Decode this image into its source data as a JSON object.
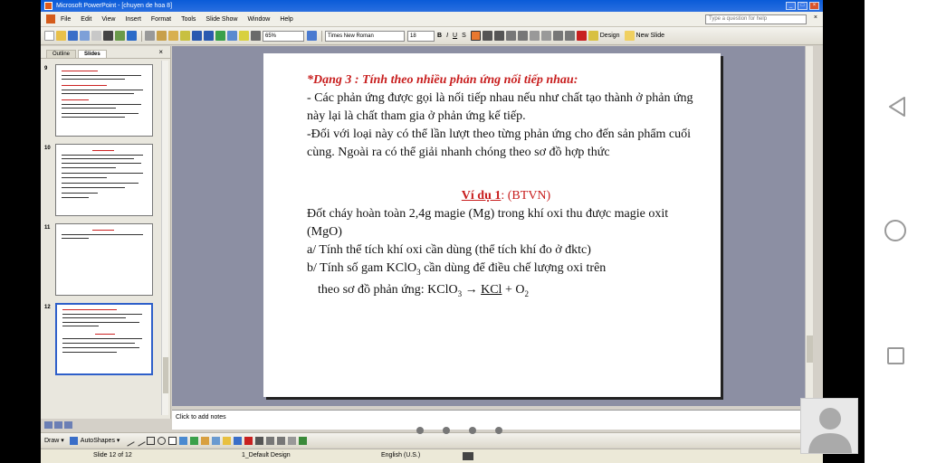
{
  "window": {
    "title": "Microsoft PowerPoint - [chuyen de hoa 8]",
    "help_placeholder": "Type a question for help"
  },
  "menu": [
    "File",
    "Edit",
    "View",
    "Insert",
    "Format",
    "Tools",
    "Slide Show",
    "Window",
    "Help"
  ],
  "toolbar": {
    "zoom": "65%",
    "font": "Times New Roman",
    "font_size": "18",
    "bold": "B",
    "italic": "I",
    "underline": "U",
    "shadow": "S",
    "design": "Design",
    "new_slide": "New Slide"
  },
  "panel": {
    "tabs": [
      "Outline",
      "Slides"
    ],
    "thumbnails": [
      {
        "num": "9"
      },
      {
        "num": "10"
      },
      {
        "num": "11"
      },
      {
        "num": "12"
      }
    ]
  },
  "slide": {
    "heading": "*Dạng  3 : Tính theo nhiều phản ứng nối tiếp nhau:",
    "para1": "- Các phản ứng được gọi là nối tiếp nhau nếu như chất tạo thành ở phản ứng này lại là chất tham gia ở phản ứng kế tiếp.",
    "para2": "-Đối với loại này có thể lần lượt theo từng phản ứng cho đến sản phẩm cuối cùng. Ngoài ra có thể giải nhanh chóng theo sơ đồ hợp thức",
    "example_label": "Ví dụ 1",
    "example_suffix": ": (BTVN)",
    "problem": " Đốt cháy hoàn toàn 2,4g magie (Mg) trong khí oxi thu được magie oxit (MgO)",
    "part_a": "a/ Tính thể tích khí oxi cần dùng (thể tích khí đo ở đktc)",
    "part_b_1": "b/ Tính số gam KClO",
    "part_b_sub": "3",
    "part_b_2": " cần dùng để điều chế lượng oxi trên",
    "scheme_prefix": "theo sơ đồ phản ứng:    KClO",
    "scheme_sub1": "3",
    "scheme_arrow": "  →  ",
    "scheme_kcl": "KCl",
    "scheme_plus": " + O",
    "scheme_sub2": "2"
  },
  "notes": {
    "placeholder": "Click to add notes"
  },
  "drawbar": {
    "draw": "Draw ▾",
    "autoshapes": "AutoShapes ▾"
  },
  "status": {
    "slide": "Slide 12 of 12",
    "design": "1_Default Design",
    "language": "English (U.S.)"
  }
}
